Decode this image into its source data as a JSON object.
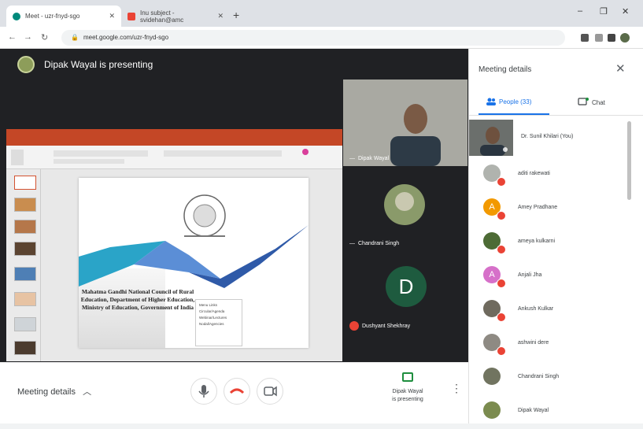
{
  "browser": {
    "tabs": [
      {
        "label": "Meet - uzr-fnyd-sgo",
        "active": true
      },
      {
        "label": "Inu subject - svidehan@amc",
        "active": false
      }
    ],
    "new_tab": "+",
    "window_controls": [
      "–",
      "❐",
      "✕"
    ],
    "url": "meet.google.com/uzr-fnyd-sgo"
  },
  "meeting": {
    "presenter_banner": "Dipak Wayal is presenting",
    "slide_text": "Mahatma Gandhi National Council of Rural Education, Department of Higher Education, Ministry of Education, Government of India",
    "slide_box_items": [
      "Menu Links",
      "Circular/Agenda",
      "Webinar/Lectures",
      "Nodal/Agencies"
    ],
    "tiles": [
      {
        "name": "Dipak Wayal"
      },
      {
        "name": "Chandrani Singh"
      },
      {
        "name": "Dushyant Shekhray",
        "avatar_letter": "D"
      }
    ]
  },
  "controls": {
    "meeting_details": "Meeting details",
    "mic_icon": "mic-icon",
    "hangup_icon": "hangup-icon",
    "camera_icon": "camera-icon",
    "present_line1": "Dipak Wayal",
    "present_line2": "is presenting",
    "more_icon": "more-vert-icon"
  },
  "panel": {
    "title": "Meeting details",
    "close": "✕",
    "tabs": {
      "people": "People (33)",
      "chat": "Chat"
    },
    "self": "Dr. Sunil Khilari (You)",
    "participants": [
      {
        "name": "aditi rakewati",
        "color": "#b0b3ae"
      },
      {
        "name": "Amey Pradhane",
        "color": "#f29900",
        "letter": "A"
      },
      {
        "name": "ameya kulkarni",
        "color": "#4d6b35"
      },
      {
        "name": "Anjali Jha",
        "color": "#d670c9",
        "letter": "A"
      },
      {
        "name": "Ankush Kulkar",
        "color": "#6f6a5e"
      },
      {
        "name": "ashwini dere",
        "color": "#8e8a83"
      },
      {
        "name": "Chandrani Singh",
        "color": "#717460"
      },
      {
        "name": "Dipak Wayal",
        "color": "#7b8b4f"
      }
    ]
  }
}
